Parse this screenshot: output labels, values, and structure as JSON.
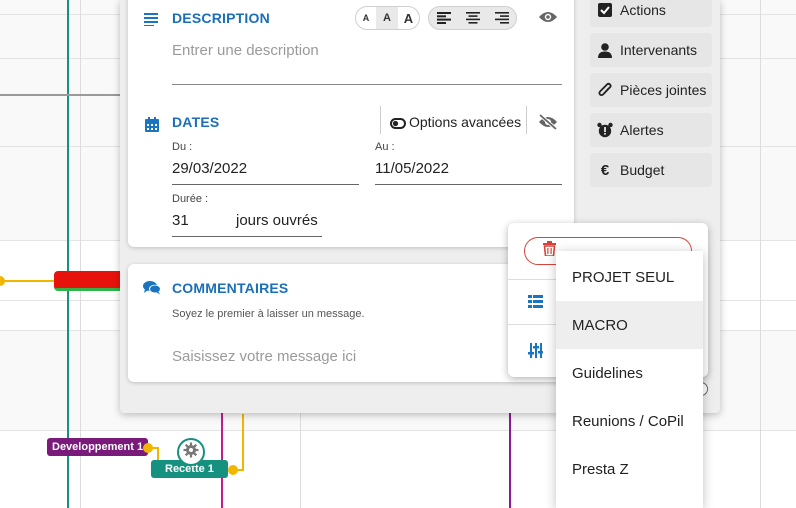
{
  "panel": {
    "description": {
      "title": "DESCRIPTION",
      "placeholder": "Entrer une description",
      "font_sizes": [
        "A",
        "A",
        "A"
      ]
    },
    "dates": {
      "title": "DATES",
      "advanced_label": "Options avancées",
      "start_label": "Du :",
      "start_value": "29/03/2022",
      "end_label": "Au :",
      "end_value": "11/05/2022",
      "duration_label": "Durée :",
      "duration_value": "31",
      "duration_unit": "jours ouvrés"
    },
    "comments": {
      "title": "COMMENTAIRES",
      "hint": "Soyez le premier à laisser un message.",
      "placeholder": "Saisissez votre message ici"
    }
  },
  "sidebar": {
    "items": [
      {
        "label": "Actions",
        "icon": "checkbox-icon"
      },
      {
        "label": "Intervenants",
        "icon": "user-icon"
      },
      {
        "label": "Pièces jointes",
        "icon": "paperclip-icon"
      },
      {
        "label": "Alertes",
        "icon": "alarm-clock-icon"
      },
      {
        "label": "Budget",
        "icon": "euro-icon"
      }
    ]
  },
  "dropdown": {
    "items": [
      "PROJET SEUL",
      "MACRO",
      "Guidelines",
      "Reunions / CoPil",
      "Presta Z"
    ],
    "highlighted_index": 1
  },
  "gantt": {
    "labels": [
      "Developpement 1",
      "Recette 1"
    ]
  },
  "colors": {
    "accent_blue": "#1a6fb8",
    "teal": "#17917f",
    "purple_label": "#7a1a7a",
    "danger": "#d8423a",
    "bar_red": "#e8120d",
    "link_yellow": "#f3b600"
  }
}
